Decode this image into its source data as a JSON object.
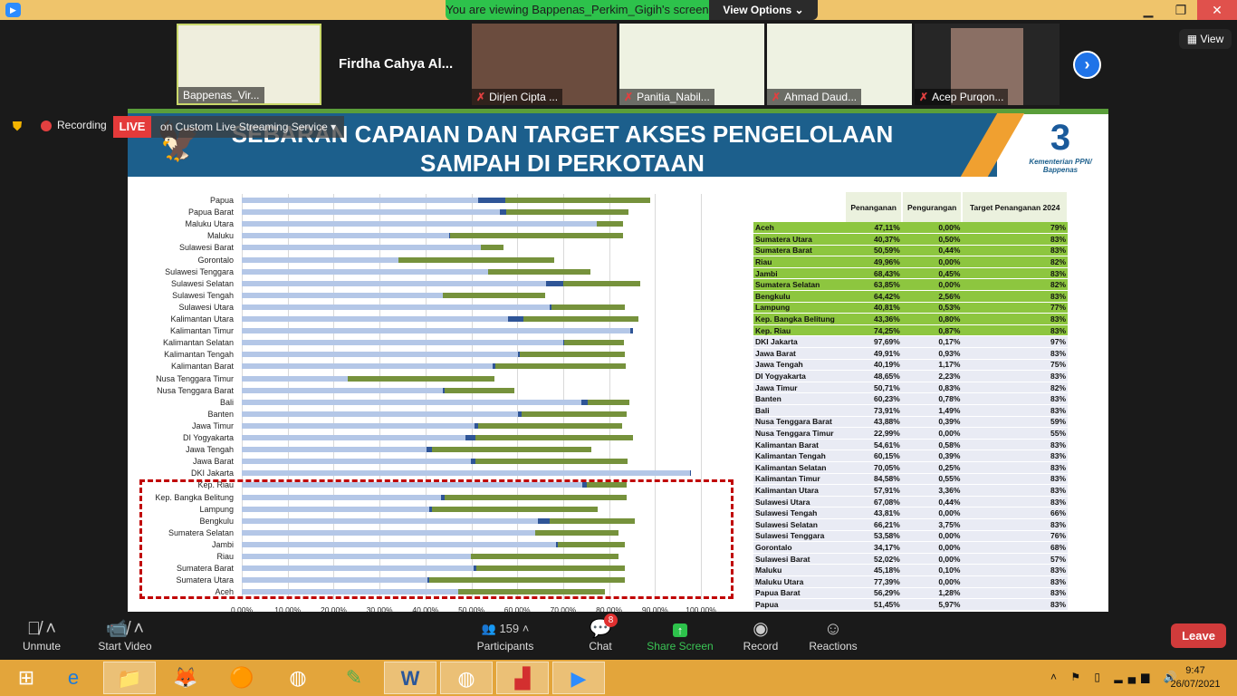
{
  "window": {
    "banner": "You are viewing Bappenas_Perkim_Gigih's screen",
    "view_options": "View Options ⌄",
    "minimize": "▁",
    "restore": "❐",
    "close": "✕",
    "view_button": "View"
  },
  "participants_strip": [
    {
      "name": "Bappenas_Vir...",
      "muted": false
    },
    {
      "name": "Firdha Cahya Al...",
      "video": false
    },
    {
      "name": "Dirjen Cipta ...",
      "muted": true
    },
    {
      "name": "Panitia_Nabil...",
      "muted": true
    },
    {
      "name": "Ahmad Daud...",
      "muted": true
    },
    {
      "name": "Acep Purqon...",
      "muted": true
    }
  ],
  "recording": {
    "label": "Recording",
    "live": "LIVE",
    "service": "on Custom Live Streaming Service ▾"
  },
  "slide": {
    "title_line1": "SEBARAN CAPAIAN DAN TARGET AKSES PENGELOLAAN",
    "title_line2": "SAMPAH DI PERKOTAAN",
    "logo_text_1": "Kementerian PPN/",
    "logo_text_2": "Bappenas",
    "table": {
      "headers": [
        "",
        "Penanganan",
        "Pengurangan",
        "Target Penanganan 2024"
      ],
      "rows": [
        [
          "Aceh",
          "47,11%",
          "0,00%",
          "79%",
          true
        ],
        [
          "Sumatera Utara",
          "40,37%",
          "0,50%",
          "83%",
          true
        ],
        [
          "Sumatera Barat",
          "50,59%",
          "0,44%",
          "83%",
          true
        ],
        [
          "Riau",
          "49,96%",
          "0,00%",
          "82%",
          true
        ],
        [
          "Jambi",
          "68,43%",
          "0,45%",
          "83%",
          true
        ],
        [
          "Sumatera Selatan",
          "63,85%",
          "0,00%",
          "82%",
          true
        ],
        [
          "Bengkulu",
          "64,42%",
          "2,56%",
          "83%",
          true
        ],
        [
          "Lampung",
          "40,81%",
          "0,53%",
          "77%",
          true
        ],
        [
          "Kep. Bangka Belitung",
          "43,36%",
          "0,80%",
          "83%",
          true
        ],
        [
          "Kep. Riau",
          "74,25%",
          "0,87%",
          "83%",
          true
        ],
        [
          "DKI Jakarta",
          "97,69%",
          "0,17%",
          "97%",
          false
        ],
        [
          "Jawa Barat",
          "49,91%",
          "0,93%",
          "83%",
          false
        ],
        [
          "Jawa Tengah",
          "40,19%",
          "1,17%",
          "75%",
          false
        ],
        [
          "DI Yogyakarta",
          "48,65%",
          "2,23%",
          "83%",
          false
        ],
        [
          "Jawa Timur",
          "50,71%",
          "0,83%",
          "82%",
          false
        ],
        [
          "Banten",
          "60,23%",
          "0,78%",
          "83%",
          false
        ],
        [
          "Bali",
          "73,91%",
          "1,49%",
          "83%",
          false
        ],
        [
          "Nusa Tenggara Barat",
          "43,88%",
          "0,39%",
          "59%",
          false
        ],
        [
          "Nusa Tenggara Timur",
          "22,99%",
          "0,00%",
          "55%",
          false
        ],
        [
          "Kalimantan Barat",
          "54,61%",
          "0,58%",
          "83%",
          false
        ],
        [
          "Kalimantan Tengah",
          "60,15%",
          "0,39%",
          "83%",
          false
        ],
        [
          "Kalimantan Selatan",
          "70,05%",
          "0,25%",
          "83%",
          false
        ],
        [
          "Kalimantan Timur",
          "84,58%",
          "0,55%",
          "83%",
          false
        ],
        [
          "Kalimantan Utara",
          "57,91%",
          "3,36%",
          "83%",
          false
        ],
        [
          "Sulawesi Utara",
          "67,08%",
          "0,44%",
          "83%",
          false
        ],
        [
          "Sulawesi Tengah",
          "43,81%",
          "0,00%",
          "66%",
          false
        ],
        [
          "Sulawesi Selatan",
          "66,21%",
          "3,75%",
          "83%",
          false
        ],
        [
          "Sulawesi Tenggara",
          "53,58%",
          "0,00%",
          "76%",
          false
        ],
        [
          "Gorontalo",
          "34,17%",
          "0,00%",
          "68%",
          false
        ],
        [
          "Sulawesi Barat",
          "52,02%",
          "0,00%",
          "57%",
          false
        ],
        [
          "Maluku",
          "45,18%",
          "0,10%",
          "83%",
          false
        ],
        [
          "Maluku Utara",
          "77,39%",
          "0,00%",
          "83%",
          false
        ],
        [
          "Papua Barat",
          "56,29%",
          "1,28%",
          "83%",
          false
        ],
        [
          "Papua",
          "51,45%",
          "5,97%",
          "83%",
          false
        ]
      ]
    }
  },
  "chart_data": {
    "type": "bar",
    "orientation": "horizontal",
    "stacked": true,
    "categories": [
      "Aceh",
      "Sumatera Utara",
      "Sumatera Barat",
      "Riau",
      "Jambi",
      "Sumatera Selatan",
      "Bengkulu",
      "Lampung",
      "Kep. Bangka Belitung",
      "Kep. Riau",
      "DKI Jakarta",
      "Jawa Barat",
      "Jawa Tengah",
      "DI Yogyakarta",
      "Jawa Timur",
      "Banten",
      "Bali",
      "Nusa Tenggara Barat",
      "Nusa Tenggara Timur",
      "Kalimantan Barat",
      "Kalimantan Tengah",
      "Kalimantan Selatan",
      "Kalimantan Timur",
      "Kalimantan Utara",
      "Sulawesi Utara",
      "Sulawesi Tengah",
      "Sulawesi Selatan",
      "Sulawesi Tenggara",
      "Gorontalo",
      "Sulawesi Barat",
      "Maluku",
      "Maluku Utara",
      "Papua Barat",
      "Papua"
    ],
    "series": [
      {
        "values": [
          47.11,
          40.37,
          50.59,
          49.96,
          68.43,
          63.85,
          64.42,
          40.81,
          43.36,
          74.25,
          97.69,
          49.91,
          40.19,
          48.65,
          50.71,
          60.23,
          73.91,
          43.88,
          22.99,
          54.61,
          60.15,
          70.05,
          84.58,
          57.91,
          67.08,
          43.81,
          66.21,
          53.58,
          34.17,
          52.02,
          45.18,
          77.39,
          56.29,
          51.45
        ],
        "color": "#b4c7e7"
      },
      {
        "values": [
          0,
          0.5,
          0.44,
          0,
          0.45,
          0,
          2.56,
          0.53,
          0.8,
          0.87,
          0.17,
          0.93,
          1.17,
          2.23,
          0.83,
          0.78,
          1.49,
          0.39,
          0,
          0.58,
          0.39,
          0.25,
          0.55,
          3.36,
          0.44,
          0,
          3.75,
          0,
          0,
          0,
          0.1,
          0,
          1.28,
          5.97
        ],
        "color": "#2f5597"
      },
      {
        "values": [
          79,
          83,
          83,
          82,
          83,
          82,
          83,
          77,
          83,
          83,
          97,
          83,
          75,
          83,
          82,
          83,
          83,
          59,
          55,
          83,
          83,
          83,
          83,
          83,
          83,
          66,
          83,
          76,
          68,
          57,
          83,
          83,
          83,
          83
        ],
        "color": "#76923c",
        "role": "target (gap drawn as target minus penanganan)"
      }
    ],
    "xticks": [
      "0,00%",
      "10,00%",
      "20,00%",
      "30,00%",
      "40,00%",
      "50,00%",
      "60,00%",
      "70,00%",
      "80,00%",
      "90,00%",
      "100,00%"
    ],
    "xlim": [
      0,
      100
    ],
    "grid": true,
    "highlight": [
      "Aceh",
      "Sumatera Utara",
      "Sumatera Barat",
      "Riau",
      "Jambi",
      "Sumatera Selatan",
      "Bengkulu",
      "Lampung",
      "Kep. Bangka Belitung",
      "Kep. Riau"
    ],
    "highlight_color": "#c00000"
  },
  "toolbar": {
    "unmute": "Unmute",
    "start_video": "Start Video",
    "participants": "Participants",
    "participant_count": "159",
    "chat": "Chat",
    "chat_badge": "8",
    "share_screen": "Share Screen",
    "record": "Record",
    "reactions": "Reactions",
    "leave": "Leave"
  },
  "taskbar": {
    "time": "9:47",
    "date": "26/07/2021"
  },
  "colors": {
    "green_rows": "#8dc63f",
    "banner": "#2dc24b",
    "leave": "#d13b3b",
    "slide_band": "#1c5f8c"
  }
}
